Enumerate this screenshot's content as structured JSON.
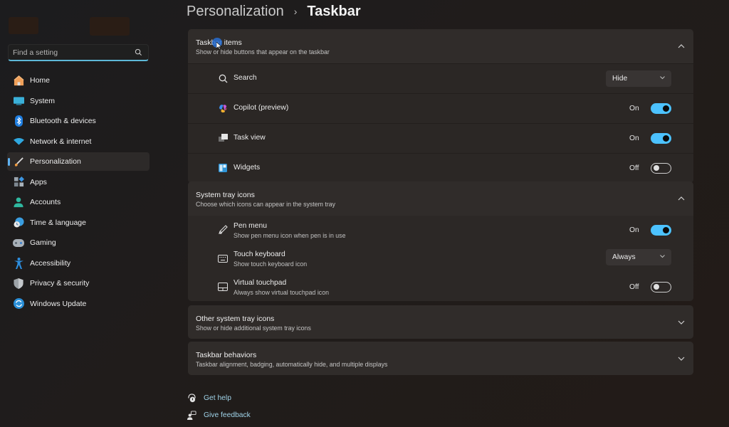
{
  "search": {
    "placeholder": "Find a setting"
  },
  "sidebar": {
    "items": [
      {
        "label": "Home",
        "icon": "home-icon",
        "active": false
      },
      {
        "label": "System",
        "icon": "system-icon",
        "active": false
      },
      {
        "label": "Bluetooth & devices",
        "icon": "bluetooth-icon",
        "active": false
      },
      {
        "label": "Network & internet",
        "icon": "wifi-icon",
        "active": false
      },
      {
        "label": "Personalization",
        "icon": "brush-icon",
        "active": true
      },
      {
        "label": "Apps",
        "icon": "apps-icon",
        "active": false
      },
      {
        "label": "Accounts",
        "icon": "accounts-icon",
        "active": false
      },
      {
        "label": "Time & language",
        "icon": "clock-globe-icon",
        "active": false
      },
      {
        "label": "Gaming",
        "icon": "gamepad-icon",
        "active": false
      },
      {
        "label": "Accessibility",
        "icon": "accessibility-icon",
        "active": false
      },
      {
        "label": "Privacy & security",
        "icon": "shield-icon",
        "active": false
      },
      {
        "label": "Windows Update",
        "icon": "update-icon",
        "active": false
      }
    ]
  },
  "header": {
    "breadcrumb_parent": "Personalization",
    "separator": "›",
    "current": "Taskbar"
  },
  "sections": {
    "taskbar_items": {
      "title": "Taskbar items",
      "subtitle": "Show or hide buttons that appear on the taskbar",
      "expanded": true,
      "rows": [
        {
          "label": "Search",
          "icon": "search-icon",
          "control": "dropdown",
          "value": "Hide"
        },
        {
          "label": "Copilot (preview)",
          "icon": "copilot-icon",
          "control": "toggle",
          "state": "On",
          "on": true
        },
        {
          "label": "Task view",
          "icon": "task-view-icon",
          "control": "toggle",
          "state": "On",
          "on": true
        },
        {
          "label": "Widgets",
          "icon": "widgets-icon",
          "control": "toggle",
          "state": "Off",
          "on": false
        }
      ]
    },
    "system_tray": {
      "title": "System tray icons",
      "subtitle": "Choose which icons can appear in the system tray",
      "expanded": true,
      "rows": [
        {
          "label": "Pen menu",
          "sub": "Show pen menu icon when pen is in use",
          "icon": "pen-icon",
          "control": "toggle",
          "state": "On",
          "on": true
        },
        {
          "label": "Touch keyboard",
          "sub": "Show touch keyboard icon",
          "icon": "keyboard-icon",
          "control": "dropdown",
          "value": "Always"
        },
        {
          "label": "Virtual touchpad",
          "sub": "Always show virtual touchpad icon",
          "icon": "touchpad-icon",
          "control": "toggle",
          "state": "Off",
          "on": false
        }
      ]
    },
    "other_tray": {
      "title": "Other system tray icons",
      "subtitle": "Show or hide additional system tray icons",
      "expanded": false
    },
    "behaviors": {
      "title": "Taskbar behaviors",
      "subtitle": "Taskbar alignment, badging, automatically hide, and multiple displays",
      "expanded": false
    }
  },
  "links": {
    "help": "Get help",
    "feedback": "Give feedback"
  },
  "colors": {
    "accent": "#4cc2ff",
    "link": "#9fd3e8"
  }
}
